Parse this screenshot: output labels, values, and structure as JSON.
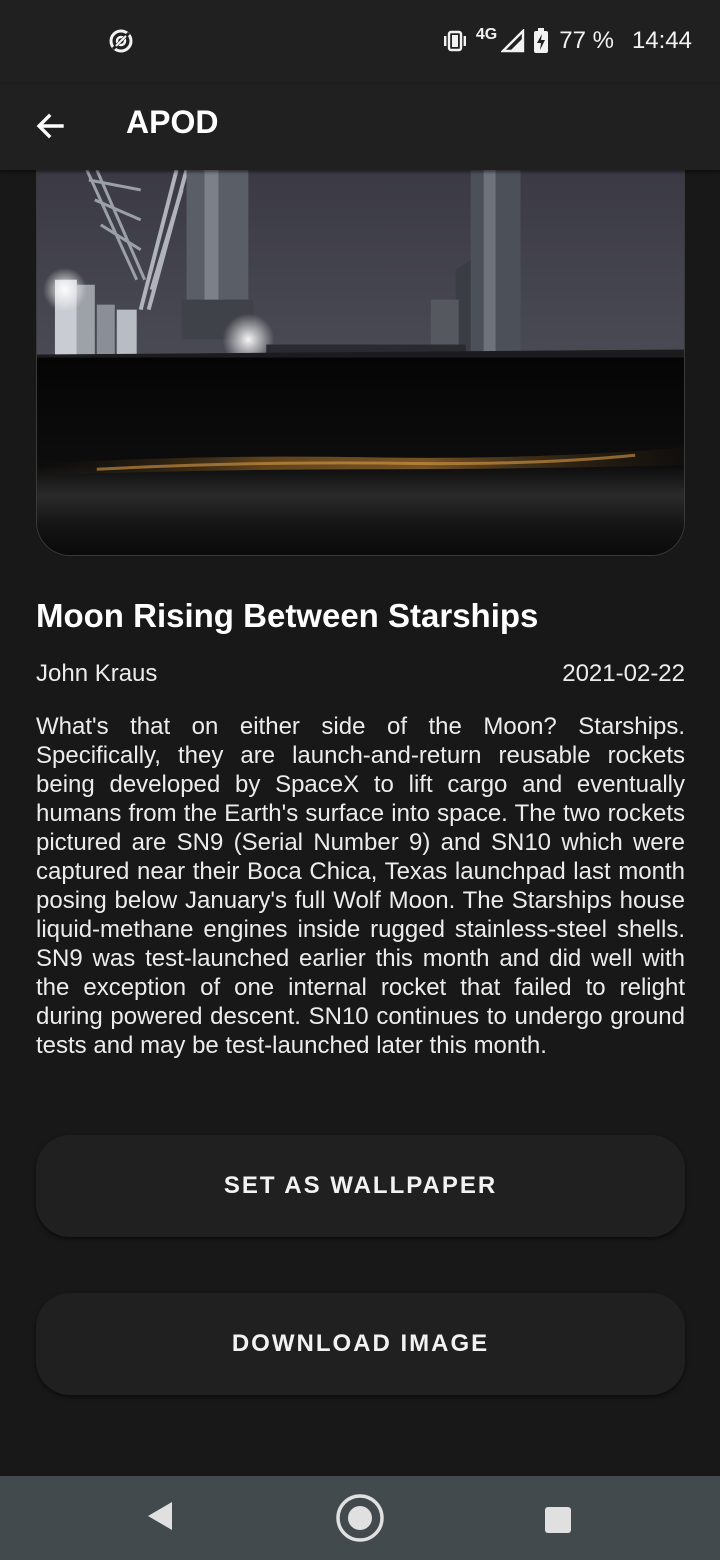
{
  "status_bar": {
    "left_icon": "data-saver-icon",
    "network_type": "4G",
    "battery_percent": "77 %",
    "time": "14:44",
    "icons": [
      "vibrate-icon",
      "signal-icon",
      "battery-charging-icon"
    ]
  },
  "app_bar": {
    "back_icon": "arrow-back-icon",
    "title": "APOD"
  },
  "apod": {
    "image_alt": "Starships at night launch site photo",
    "title": "Moon Rising Between Starships",
    "author": "John Kraus",
    "date": "2021-02-22",
    "explanation": "What's that on either side of the Moon? Starships. Specifically, they are launch-and-return reusable rockets being developed by SpaceX to lift cargo and eventually humans from the Earth's surface into space.  The two rockets pictured are SN9 (Serial Number 9) and SN10 which were captured near their Boca Chica, Texas launchpad last month posing below January's full Wolf Moon. The Starships house liquid-methane engines inside rugged stainless-steel shells. SN9 was test-launched earlier this month and did well with the exception of one internal rocket that failed to relight during powered descent. SN10 continues to undergo ground tests and may be test-launched later this month."
  },
  "actions": {
    "wallpaper_label": "SET AS WALLPAPER",
    "download_label": "DOWNLOAD IMAGE"
  },
  "nav_bar": {
    "icons": [
      "nav-back-icon",
      "nav-home-icon",
      "nav-recents-icon"
    ]
  },
  "colors": {
    "background": "#181818",
    "surface": "#202020",
    "nav_bar": "#434a4e",
    "text": "#ffffff"
  }
}
